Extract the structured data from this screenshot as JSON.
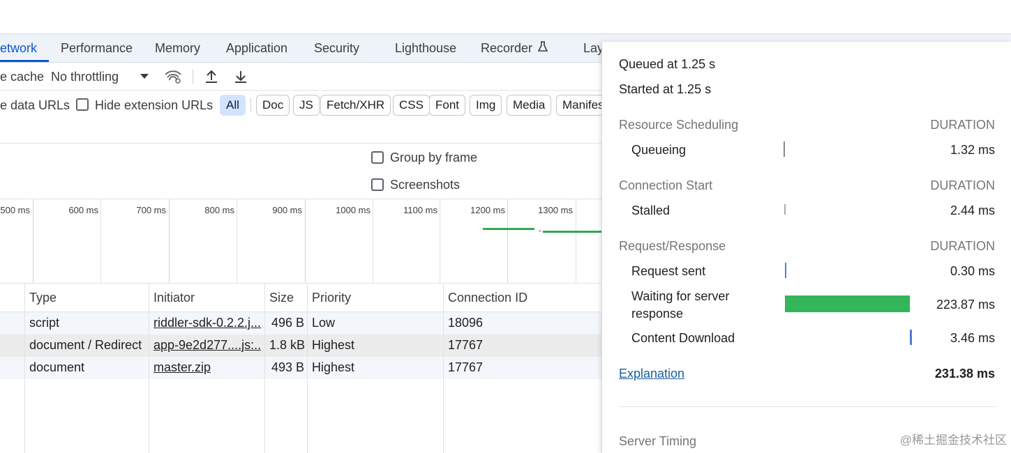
{
  "tabs": [
    {
      "label": "etwork",
      "active": true
    },
    {
      "label": "Performance"
    },
    {
      "label": "Memory"
    },
    {
      "label": "Application"
    },
    {
      "label": "Security"
    },
    {
      "label": "Lighthouse"
    },
    {
      "label": "Recorder"
    },
    {
      "label": "Lay"
    }
  ],
  "toolbar": {
    "cache_label": "e cache",
    "throttling_value": "No throttling",
    "throttle_icon": "chevron-down-icon",
    "wifi_icon": "network-conditions-icon",
    "upload_icon": "import-har-icon",
    "download_icon": "export-har-icon"
  },
  "filters": {
    "data_urls_label": "e data URLs",
    "hide_extension_label": "Hide extension URLs",
    "chips": [
      "All",
      "Doc",
      "JS",
      "Fetch/XHR",
      "CSS",
      "Font",
      "Img",
      "Media",
      "Manifes"
    ]
  },
  "options": {
    "group_by_frame": "Group by frame",
    "screenshots": "Screenshots"
  },
  "timeline": {
    "ticks": [
      "500 ms",
      "600 ms",
      "700 ms",
      "800 ms",
      "900 ms",
      "1000 ms",
      "1100 ms",
      "1200 ms",
      "1300 ms"
    ]
  },
  "table": {
    "headers": [
      "Type",
      "Initiator",
      "Size",
      "Priority",
      "Connection ID"
    ],
    "rows": [
      {
        "type": "script",
        "initiator": "riddler-sdk-0.2.2.j...",
        "size": "496 B",
        "priority": "Low",
        "connection": "18096"
      },
      {
        "type": "document / Redirect",
        "initiator": "app-9e2d277....js:...",
        "size": "1.8 kB",
        "priority": "Highest",
        "connection": "17767"
      },
      {
        "type": "document",
        "initiator": "master.zip",
        "size": "493 B",
        "priority": "Highest",
        "connection": "17767"
      }
    ]
  },
  "timing": {
    "queued": "Queued at 1.25 s",
    "started": "Started at 1.25 s",
    "duration_header": "DURATION",
    "sections": [
      {
        "title": "Resource Scheduling",
        "items": [
          {
            "label": "Queueing",
            "value": "1.32 ms"
          }
        ]
      },
      {
        "title": "Connection Start",
        "items": [
          {
            "label": "Stalled",
            "value": "2.44 ms"
          }
        ]
      },
      {
        "title": "Request/Response",
        "items": [
          {
            "label": "Request sent",
            "value": "0.30 ms"
          },
          {
            "label": "Waiting for server",
            "label2": "response",
            "value": "223.87 ms"
          },
          {
            "label": "Content Download",
            "value": "3.46 ms"
          }
        ]
      }
    ],
    "explanation": "Explanation",
    "total": "231.38 ms",
    "server_timing": "Server Timing"
  },
  "colors": {
    "accent": "#0b57d0",
    "waiting_bar": "#34b55a",
    "download_bar": "#4a7fd4",
    "queue_bar": "#8a8a8a"
  },
  "watermark": "@稀土掘金技术社区"
}
